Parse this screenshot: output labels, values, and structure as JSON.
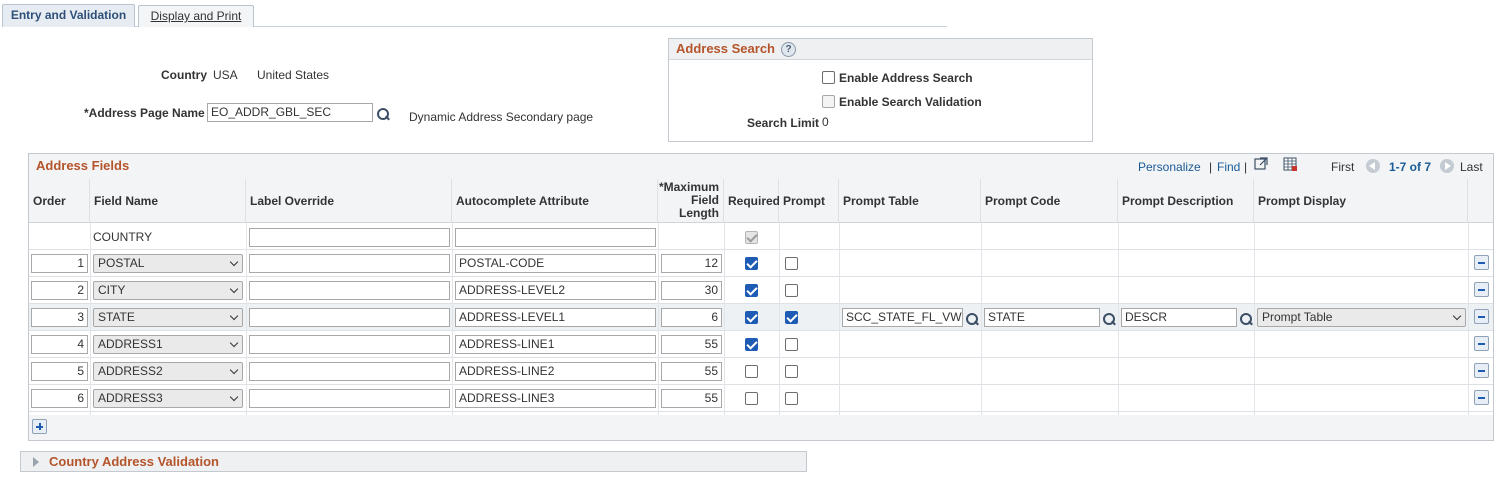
{
  "tabs": [
    {
      "label": "Entry and Validation"
    },
    {
      "label": "Display and Print"
    }
  ],
  "country": {
    "label": "Country",
    "code": "USA",
    "name": "United States"
  },
  "address_page": {
    "label": "*Address Page Name",
    "value": "EO_ADDR_GBL_SEC",
    "description": "Dynamic Address Secondary page"
  },
  "address_search": {
    "title": "Address Search",
    "enable_label": "Enable Address Search",
    "validation_label": "Enable Search Validation",
    "limit_label": "Search Limit",
    "limit_value": "0"
  },
  "grid": {
    "title": "Address Fields",
    "personalize": "Personalize",
    "find": "Find",
    "first": "First",
    "range": "1-7 of 7",
    "last": "Last",
    "sep": "|",
    "headers": {
      "order": "Order",
      "field_name": "Field Name",
      "label_override": "Label Override",
      "autocomplete": "Autocomplete Attribute",
      "max_len": "*Maximum Field Length",
      "required": "Required",
      "prompt": "Prompt",
      "prompt_table": "Prompt Table",
      "prompt_code": "Prompt Code",
      "prompt_desc": "Prompt Description",
      "prompt_display": "Prompt Display"
    },
    "rows": [
      {
        "order": "",
        "field": "COUNTRY",
        "label": "",
        "autocomplete": "",
        "maxlen": "",
        "required": true,
        "prompt": false,
        "ptable": "",
        "pcode": "",
        "pdesc": "",
        "pdisplay": ""
      },
      {
        "order": "1",
        "field": "POSTAL",
        "label": "",
        "autocomplete": "POSTAL-CODE",
        "maxlen": "12",
        "required": true,
        "prompt": false,
        "ptable": "",
        "pcode": "",
        "pdesc": "",
        "pdisplay": ""
      },
      {
        "order": "2",
        "field": "CITY",
        "label": "",
        "autocomplete": "ADDRESS-LEVEL2",
        "maxlen": "30",
        "required": true,
        "prompt": false,
        "ptable": "",
        "pcode": "",
        "pdesc": "",
        "pdisplay": ""
      },
      {
        "order": "3",
        "field": "STATE",
        "label": "",
        "autocomplete": "ADDRESS-LEVEL1",
        "maxlen": "6",
        "required": true,
        "prompt": true,
        "ptable": "SCC_STATE_FL_VW",
        "pcode": "STATE",
        "pdesc": "DESCR",
        "pdisplay": "Prompt Table"
      },
      {
        "order": "4",
        "field": "ADDRESS1",
        "label": "",
        "autocomplete": "ADDRESS-LINE1",
        "maxlen": "55",
        "required": true,
        "prompt": false,
        "ptable": "",
        "pcode": "",
        "pdesc": "",
        "pdisplay": ""
      },
      {
        "order": "5",
        "field": "ADDRESS2",
        "label": "",
        "autocomplete": "ADDRESS-LINE2",
        "maxlen": "55",
        "required": false,
        "prompt": false,
        "ptable": "",
        "pcode": "",
        "pdesc": "",
        "pdisplay": ""
      },
      {
        "order": "6",
        "field": "ADDRESS3",
        "label": "",
        "autocomplete": "ADDRESS-LINE3",
        "maxlen": "55",
        "required": false,
        "prompt": false,
        "ptable": "",
        "pcode": "",
        "pdesc": "",
        "pdisplay": ""
      }
    ]
  },
  "country_validation": {
    "title": "Country Address Validation"
  },
  "colors": {
    "accent_title": "#b5542a",
    "link": "#1a5a96",
    "checkbox": "#1e5bb5"
  }
}
